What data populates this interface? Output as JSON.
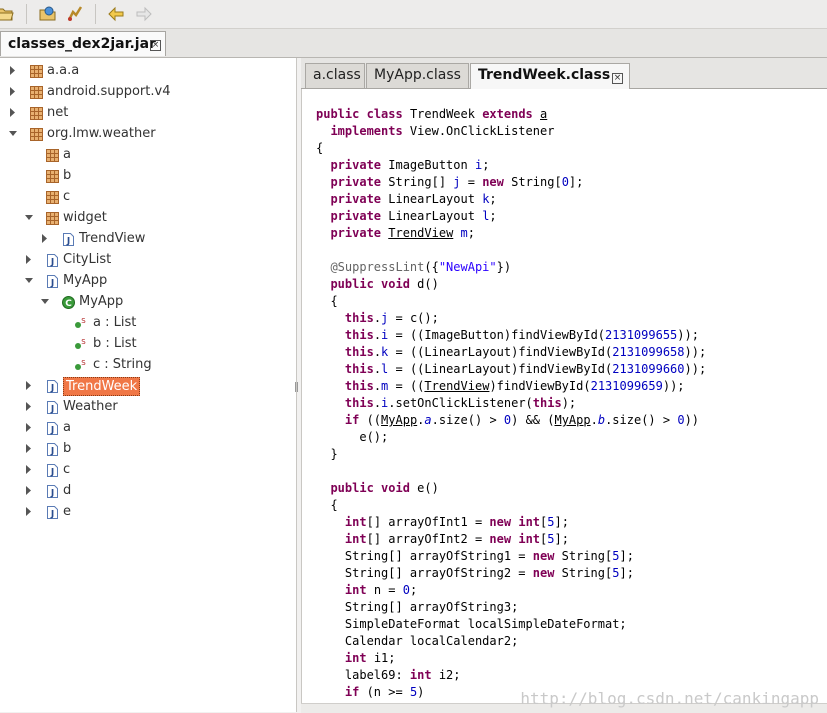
{
  "file_tab": {
    "label": "classes_dex2jar.jar"
  },
  "tree": {
    "items": [
      {
        "label": "a.a.a",
        "type": "package",
        "depth": 0,
        "twisty": "collapsed"
      },
      {
        "label": "android.support.v4",
        "type": "package",
        "depth": 0,
        "twisty": "collapsed"
      },
      {
        "label": "net",
        "type": "package",
        "depth": 0,
        "twisty": "collapsed"
      },
      {
        "label": "org.lmw.weather",
        "type": "package",
        "depth": 0,
        "twisty": "expanded"
      },
      {
        "label": "a",
        "type": "package",
        "depth": 1,
        "twisty": "none"
      },
      {
        "label": "b",
        "type": "package",
        "depth": 1,
        "twisty": "none"
      },
      {
        "label": "c",
        "type": "package",
        "depth": 1,
        "twisty": "none"
      },
      {
        "label": "widget",
        "type": "package",
        "depth": 1,
        "twisty": "expanded"
      },
      {
        "label": "TrendView",
        "type": "java",
        "depth": 2,
        "twisty": "collapsed"
      },
      {
        "label": "CityList",
        "type": "java",
        "depth": 1,
        "twisty": "collapsed"
      },
      {
        "label": "MyApp",
        "type": "java",
        "depth": 1,
        "twisty": "expanded"
      },
      {
        "label": "MyApp",
        "type": "class",
        "depth": 2,
        "twisty": "expanded"
      },
      {
        "label": "a : List",
        "type": "field",
        "depth": 3,
        "twisty": "none"
      },
      {
        "label": "b : List",
        "type": "field",
        "depth": 3,
        "twisty": "none"
      },
      {
        "label": "c : String",
        "type": "field",
        "depth": 3,
        "twisty": "none"
      },
      {
        "label": "TrendWeek",
        "type": "java",
        "depth": 1,
        "twisty": "collapsed",
        "selected": true
      },
      {
        "label": "Weather",
        "type": "java",
        "depth": 1,
        "twisty": "collapsed"
      },
      {
        "label": "a",
        "type": "java",
        "depth": 1,
        "twisty": "collapsed"
      },
      {
        "label": "b",
        "type": "java",
        "depth": 1,
        "twisty": "collapsed"
      },
      {
        "label": "c",
        "type": "java",
        "depth": 1,
        "twisty": "collapsed"
      },
      {
        "label": "d",
        "type": "java",
        "depth": 1,
        "twisty": "collapsed"
      },
      {
        "label": "e",
        "type": "java",
        "depth": 1,
        "twisty": "collapsed"
      }
    ]
  },
  "editor_tabs": [
    {
      "label": "a.class",
      "active": false
    },
    {
      "label": "MyApp.class",
      "active": false
    },
    {
      "label": "TrendWeek.class",
      "active": true
    }
  ],
  "code_lines": [
    "",
    "public class TrendWeek extends a",
    "  implements View.OnClickListener",
    "{",
    "  private ImageButton i;",
    "  private String[] j = new String[0];",
    "  private LinearLayout k;",
    "  private LinearLayout l;",
    "  private TrendView m;",
    "",
    "  @SuppressLint({\"NewApi\"})",
    "  public void d()",
    "  {",
    "    this.j = c();",
    "    this.i = ((ImageButton)findViewById(2131099655));",
    "    this.k = ((LinearLayout)findViewById(2131099658));",
    "    this.l = ((LinearLayout)findViewById(2131099660));",
    "    this.m = ((TrendView)findViewById(2131099659));",
    "    this.i.setOnClickListener(this);",
    "    if ((MyApp.a.size() > 0) && (MyApp.b.size() > 0))",
    "      e();",
    "  }",
    "",
    "  public void e()",
    "  {",
    "    int[] arrayOfInt1 = new int[5];",
    "    int[] arrayOfInt2 = new int[5];",
    "    String[] arrayOfString1 = new String[5];",
    "    String[] arrayOfString2 = new String[5];",
    "    int n = 0;",
    "    String[] arrayOfString3;",
    "    SimpleDateFormat localSimpleDateFormat;",
    "    Calendar localCalendar2;",
    "    int i1;",
    "    label69: int i2;",
    "    if (n >= 5)"
  ],
  "code_keywords": [
    "public",
    "class",
    "extends",
    "implements",
    "private",
    "new",
    "void",
    "this",
    "if",
    "int"
  ],
  "underlined_types": [
    "a",
    "TrendView",
    "MyApp"
  ],
  "fields": [
    "j",
    "i",
    "k",
    "l",
    "m"
  ],
  "static_fields": [
    "a",
    "b"
  ],
  "watermark": "http://blog.csdn.net/cankingapp",
  "colors": {
    "keyword": "#7f0055",
    "number": "#0000c0",
    "string": "#2a00ff",
    "annotation": "#646464",
    "selection": "#f07746"
  }
}
